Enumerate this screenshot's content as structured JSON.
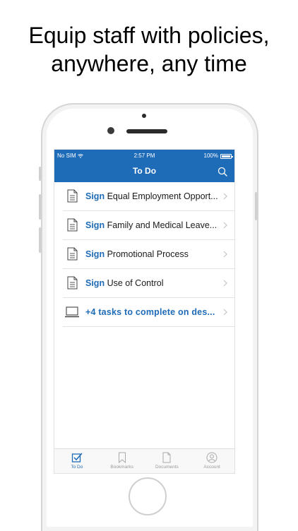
{
  "headline": {
    "line1": "Equip staff with policies,",
    "line2": "anywhere, any time"
  },
  "status_bar": {
    "carrier": "No SIM",
    "time": "2:57 PM",
    "battery": "100%"
  },
  "nav": {
    "title": "To Do",
    "search_icon": "search-icon"
  },
  "tasks": [
    {
      "action": "Sign",
      "title": "Equal Employment Opport..."
    },
    {
      "action": "Sign",
      "title": "Family and Medical Leave..."
    },
    {
      "action": "Sign",
      "title": "Promotional Process"
    },
    {
      "action": "Sign",
      "title": "Use of Control"
    }
  ],
  "more_tasks": {
    "label": "+4 tasks to complete on des..."
  },
  "tabs": [
    {
      "label": "To Do",
      "icon": "checkbox-icon",
      "active": true
    },
    {
      "label": "Bookmarks",
      "icon": "bookmark-icon",
      "active": false
    },
    {
      "label": "Documents",
      "icon": "document-icon",
      "active": false
    },
    {
      "label": "Account",
      "icon": "user-icon",
      "active": false
    }
  ],
  "colors": {
    "accent": "#1e6bb8",
    "inactive_tab": "#999999"
  }
}
